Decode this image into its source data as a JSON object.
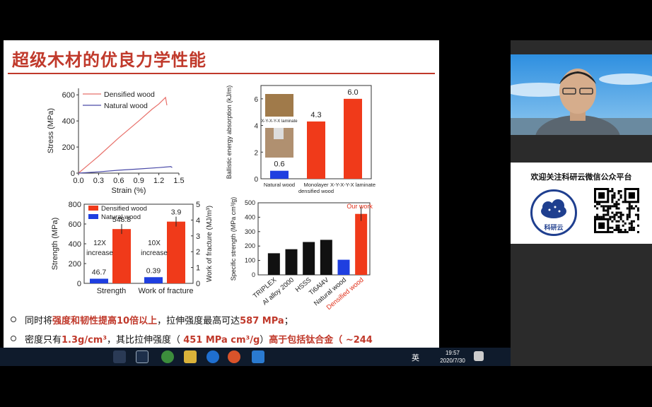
{
  "slide": {
    "title": "超级木材的优良力学性能",
    "bullets": [
      {
        "parts": [
          {
            "t": "同时将",
            "hl": false
          },
          {
            "t": "强度和韧性提高10倍以上",
            "hl": true
          },
          {
            "t": "，拉伸强度最高可达",
            "hl": false
          },
          {
            "t": "587 MPa",
            "hl": true
          },
          {
            "t": "；",
            "hl": false
          }
        ]
      },
      {
        "parts": [
          {
            "t": "密度只有",
            "hl": false
          },
          {
            "t": "1.3g/cm³",
            "hl": true
          },
          {
            "t": "，其比拉伸强度（ ",
            "hl": false
          },
          {
            "t": "451 MPa cm³/g",
            "hl": true
          },
          {
            "t": "）",
            "hl": false
          },
          {
            "t": "高于包括钛合金",
            "hl": true
          },
          {
            "t": "（ ~244",
            "hl": true
          }
        ]
      }
    ]
  },
  "chart_data": [
    {
      "type": "line",
      "xlabel": "Strain (%)",
      "ylabel": "Stress (MPa)",
      "xlim": [
        0,
        1.5
      ],
      "ylim": [
        0,
        650
      ],
      "xticks": [
        "0.0",
        "0.3",
        "0.6",
        "0.9",
        "1.2",
        "1.5"
      ],
      "yticks": [
        "0",
        "200",
        "400",
        "600"
      ],
      "series": [
        {
          "name": "Densified wood",
          "color": "#e8706a",
          "points": [
            [
              0,
              0
            ],
            [
              0.3,
              130
            ],
            [
              0.6,
              270
            ],
            [
              0.9,
              400
            ],
            [
              1.1,
              490
            ],
            [
              1.2,
              530
            ],
            [
              1.3,
              580
            ],
            [
              1.32,
              520
            ]
          ]
        },
        {
          "name": "Natural wood",
          "color": "#4a4aa8",
          "points": [
            [
              0,
              0
            ],
            [
              0.3,
              10
            ],
            [
              0.6,
              22
            ],
            [
              0.9,
              32
            ],
            [
              1.2,
              42
            ],
            [
              1.38,
              50
            ],
            [
              1.4,
              42
            ]
          ]
        }
      ]
    },
    {
      "type": "bar",
      "ylabel": "Ballistic energy absorption (kJ/m)",
      "ylim": [
        0,
        7
      ],
      "yticks": [
        "0",
        "2",
        "4",
        "6"
      ],
      "categories": [
        "Natural wood",
        "Monolayer densified wood",
        "X-Y-X-Y-X laminate"
      ],
      "values": [
        0.6,
        4.3,
        6.0
      ],
      "value_labels": [
        "0.6",
        "4.3",
        "6.0"
      ],
      "colors": [
        "#1f3fe0",
        "#f03a1a",
        "#f03a1a"
      ],
      "inset_label": "X-Y-X-Y-X laminate"
    },
    {
      "type": "bar",
      "ylabel": "Strength (MPa)",
      "y2label": "Work of fracture (MJ/m³)",
      "ylim": [
        0,
        800
      ],
      "yticks": [
        "0",
        "200",
        "400",
        "600",
        "800"
      ],
      "y2ticks": [
        "0",
        "1",
        "2",
        "3",
        "4",
        "5"
      ],
      "categories": [
        "Strength",
        "Work of fracture"
      ],
      "series": [
        {
          "name": "Densified wood",
          "color": "#f03a1a",
          "values": [
            548.8,
            3.9
          ]
        },
        {
          "name": "Natural wood",
          "color": "#1f3fe0",
          "values": [
            46.7,
            0.39
          ]
        }
      ],
      "annotations": [
        "12X increase",
        "10X increase"
      ],
      "value_labels": [
        "46.7",
        "548.8",
        "0.39",
        "3.9"
      ]
    },
    {
      "type": "bar",
      "ylabel": "Specific strength (MPa cm³/g)",
      "ylim": [
        0,
        500
      ],
      "yticks": [
        "0",
        "100",
        "200",
        "300",
        "400",
        "500"
      ],
      "categories": [
        "TRIPLEX",
        "Al alloy 2000",
        "HSSS",
        "Ti6Al4V",
        "Natural wood",
        "Densified wood"
      ],
      "values": [
        150,
        178,
        228,
        243,
        105,
        423
      ],
      "colors": [
        "#111111",
        "#111111",
        "#111111",
        "#111111",
        "#1f3fe0",
        "#f03a1a"
      ],
      "annotation": "Our work"
    }
  ],
  "taskbar": {
    "time": "19:57",
    "date": "2020/7/30",
    "ime": "英"
  },
  "promo": {
    "text": "欢迎关注科研云微信公众平台",
    "logo_text": "科研云"
  }
}
